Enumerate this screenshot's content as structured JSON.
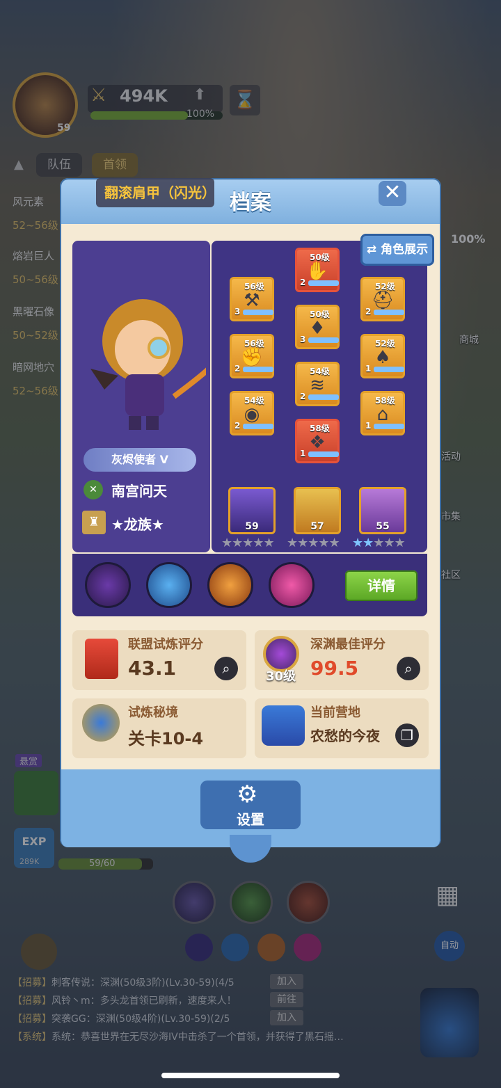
{
  "hud": {
    "avatar_level": "59",
    "power": "494K",
    "power_progress": "100%",
    "tabs": [
      "队伍",
      "首领"
    ],
    "left_list": [
      {
        "name": "风元素",
        "range": "52~56级"
      },
      {
        "name": "熔岩巨人",
        "range": "50~56级"
      },
      {
        "name": "黑曜石像",
        "range": "50~52级"
      },
      {
        "name": "暗网地穴",
        "range": "52~56级"
      }
    ],
    "right_pct": "100%",
    "right_items": [
      "商城",
      "活动",
      "市集",
      "社区"
    ],
    "reward_label": "悬赏",
    "exp_label": "EXP",
    "exp_value": "289K",
    "level_progress": "59/60",
    "auto_label": "自动"
  },
  "chat": [
    {
      "tag": "【招募】",
      "text": "刺客传说：深渊(50级3阶)(Lv.30-59)(4/5",
      "button": "加入"
    },
    {
      "tag": "【招募】",
      "text": "风铃丶m：多头龙首领已刷新，速度来人！",
      "button": "前往"
    },
    {
      "tag": "【招募】",
      "text": "突袭GG：深渊(50级4阶)(Lv.30-59)(2/5",
      "button": "加入"
    },
    {
      "tag": "【系统】",
      "text": "系统：恭喜世界在无尽沙海IV中击杀了一个首领，并获得了黑石摇…",
      "button": ""
    }
  ],
  "modal": {
    "title": "档案",
    "equip_tag": "翻滚肩甲（闪光）",
    "show_button": "角色展示",
    "player": {
      "title_badge": "灰烬使者",
      "title_rank": "V",
      "name": "南宫问天",
      "guild": "★龙族★"
    },
    "equipment": [
      {
        "level": "56级",
        "stars": "3",
        "color": "orange"
      },
      {
        "level": "50级",
        "stars": "2",
        "color": "red"
      },
      {
        "level": "52级",
        "stars": "2",
        "color": "orange"
      },
      {
        "level": "56级",
        "stars": "2",
        "color": "orange"
      },
      {
        "level": "50级",
        "stars": "3",
        "color": "orange"
      },
      {
        "level": "52级",
        "stars": "1",
        "color": "orange"
      },
      {
        "level": "54级",
        "stars": "2",
        "color": "orange"
      },
      {
        "level": "54级",
        "stars": "2",
        "color": "orange"
      },
      {
        "level": "58级",
        "stars": "1",
        "color": "orange"
      },
      {
        "level": "58级",
        "stars": "1",
        "color": "red"
      }
    ],
    "pets": [
      {
        "level": "59",
        "stars_filled": 0
      },
      {
        "level": "57",
        "stars_filled": 0
      },
      {
        "level": "55",
        "stars_filled": 2
      }
    ],
    "detail_button": "详情",
    "stats": {
      "alliance_trial": {
        "title": "联盟试炼评分",
        "value": "43.1"
      },
      "abyss_best": {
        "title": "深渊最佳评分",
        "value": "99.5",
        "badge": "30级"
      },
      "trial_realm": {
        "title": "试炼秘境",
        "value": "关卡10-4"
      },
      "current_camp": {
        "title": "当前营地",
        "value": "农愁的今夜"
      }
    },
    "settings_label": "设置"
  }
}
